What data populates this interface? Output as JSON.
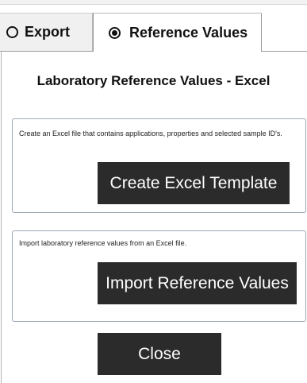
{
  "tabs": [
    {
      "label": "Export",
      "selected": false
    },
    {
      "label": "Reference Values",
      "selected": true
    }
  ],
  "page": {
    "title": "Laboratory Reference Values - Excel"
  },
  "create_group": {
    "description": "Create an Excel file that contains applications, properties and selected sample ID's.",
    "button_label": "Create Excel Template"
  },
  "import_group": {
    "description": "Import laboratory reference values from an Excel file.",
    "button_label": "Import Reference Values"
  },
  "footer": {
    "close_label": "Close"
  },
  "colors": {
    "button_bg": "#2b2b2b",
    "group_border": "#9aa7b8",
    "inactive_tab_bg": "#f0f0f0"
  }
}
